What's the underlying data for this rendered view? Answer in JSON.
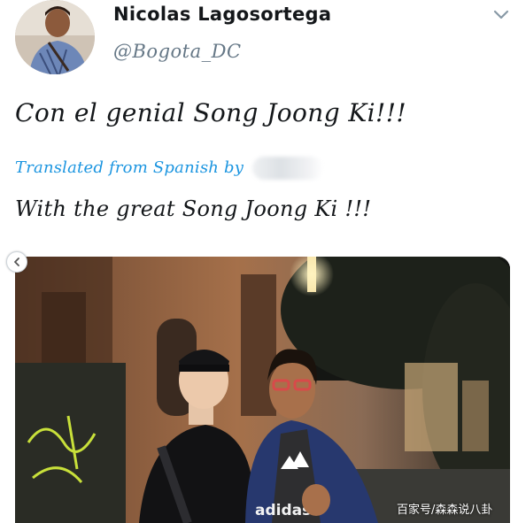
{
  "tweet": {
    "display_name": "Nicolas Lagosortega",
    "handle": "@Bogota_DC",
    "text": "Con el genial Song Joong Ki!!!",
    "translated_label": "Translated from Spanish by",
    "translation": "With the great Song Joong Ki !!!"
  },
  "photo": {
    "shirt_text": "adidas",
    "watermark": "百家号/森森说八卦"
  },
  "icons": {
    "menu": "chevron-down-icon",
    "carousel_prev": "chevron-left-icon"
  },
  "colors": {
    "link": "#1b95e0",
    "secondary_text": "#657786",
    "primary_text": "#14171a"
  }
}
